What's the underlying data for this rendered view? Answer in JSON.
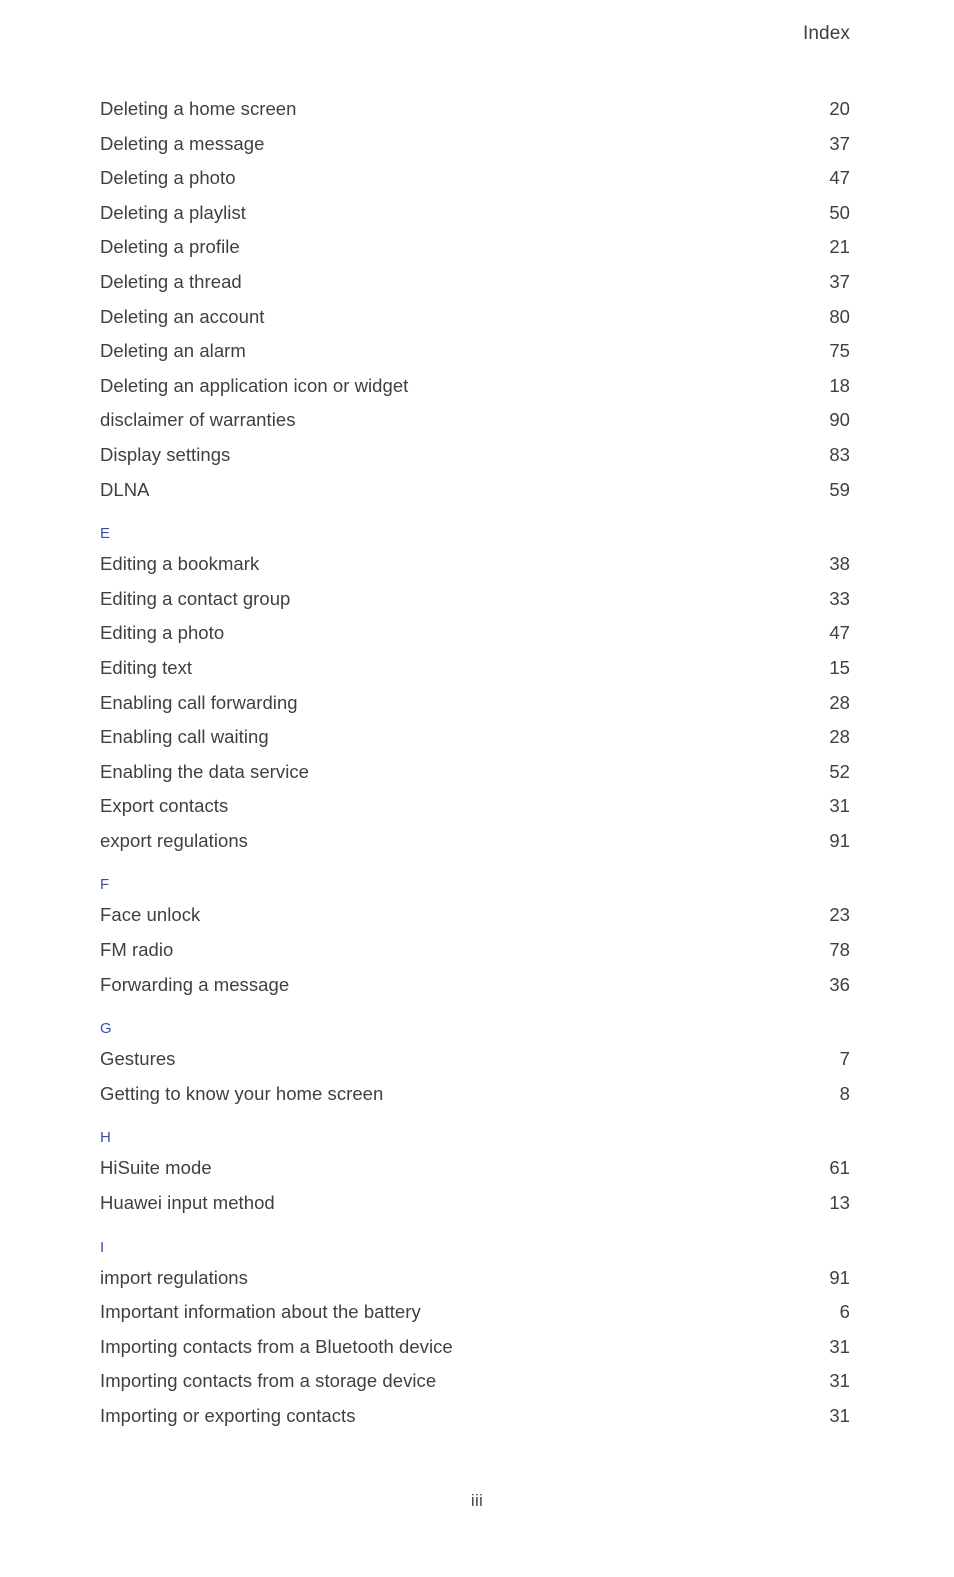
{
  "header": {
    "running_head": "Index"
  },
  "footer": {
    "folio": "iii"
  },
  "colors": {
    "section_letter": "#3b50a4",
    "body_text": "#404040",
    "page_background": "#ffffff"
  },
  "index": {
    "sections": [
      {
        "letter": "",
        "entries": [
          {
            "label": "Deleting a home screen",
            "page": "20"
          },
          {
            "label": "Deleting a message",
            "page": "37"
          },
          {
            "label": "Deleting a photo",
            "page": "47"
          },
          {
            "label": "Deleting a playlist",
            "page": "50"
          },
          {
            "label": "Deleting a profile",
            "page": "21"
          },
          {
            "label": "Deleting a thread",
            "page": "37"
          },
          {
            "label": "Deleting an account",
            "page": "80"
          },
          {
            "label": "Deleting an alarm",
            "page": "75"
          },
          {
            "label": "Deleting an application icon or widget",
            "page": "18"
          },
          {
            "label": "disclaimer of warranties",
            "page": "90"
          },
          {
            "label": "Display settings",
            "page": "83"
          },
          {
            "label": "DLNA",
            "page": "59"
          }
        ]
      },
      {
        "letter": "E",
        "entries": [
          {
            "label": "Editing a bookmark",
            "page": "38"
          },
          {
            "label": "Editing a contact group",
            "page": "33"
          },
          {
            "label": "Editing a photo",
            "page": "47"
          },
          {
            "label": "Editing text",
            "page": "15"
          },
          {
            "label": "Enabling call forwarding",
            "page": "28"
          },
          {
            "label": "Enabling call waiting",
            "page": "28"
          },
          {
            "label": "Enabling the data service",
            "page": "52"
          },
          {
            "label": "Export contacts",
            "page": "31"
          },
          {
            "label": "export regulations",
            "page": "91"
          }
        ]
      },
      {
        "letter": "F",
        "entries": [
          {
            "label": "Face unlock",
            "page": "23"
          },
          {
            "label": "FM radio",
            "page": "78"
          },
          {
            "label": "Forwarding a message",
            "page": "36"
          }
        ]
      },
      {
        "letter": "G",
        "entries": [
          {
            "label": "Gestures",
            "page": "7"
          },
          {
            "label": "Getting to know your home screen",
            "page": "8"
          }
        ]
      },
      {
        "letter": "H",
        "entries": [
          {
            "label": "HiSuite mode",
            "page": "61"
          },
          {
            "label": "Huawei input method",
            "page": "13"
          }
        ]
      },
      {
        "letter": "I",
        "entries": [
          {
            "label": "import regulations",
            "page": "91"
          },
          {
            "label": "Important information about the battery",
            "page": "6"
          },
          {
            "label": "Importing contacts from a Bluetooth device",
            "page": "31"
          },
          {
            "label": "Importing contacts from a storage device",
            "page": "31"
          },
          {
            "label": "Importing or exporting contacts",
            "page": "31"
          }
        ]
      }
    ]
  }
}
